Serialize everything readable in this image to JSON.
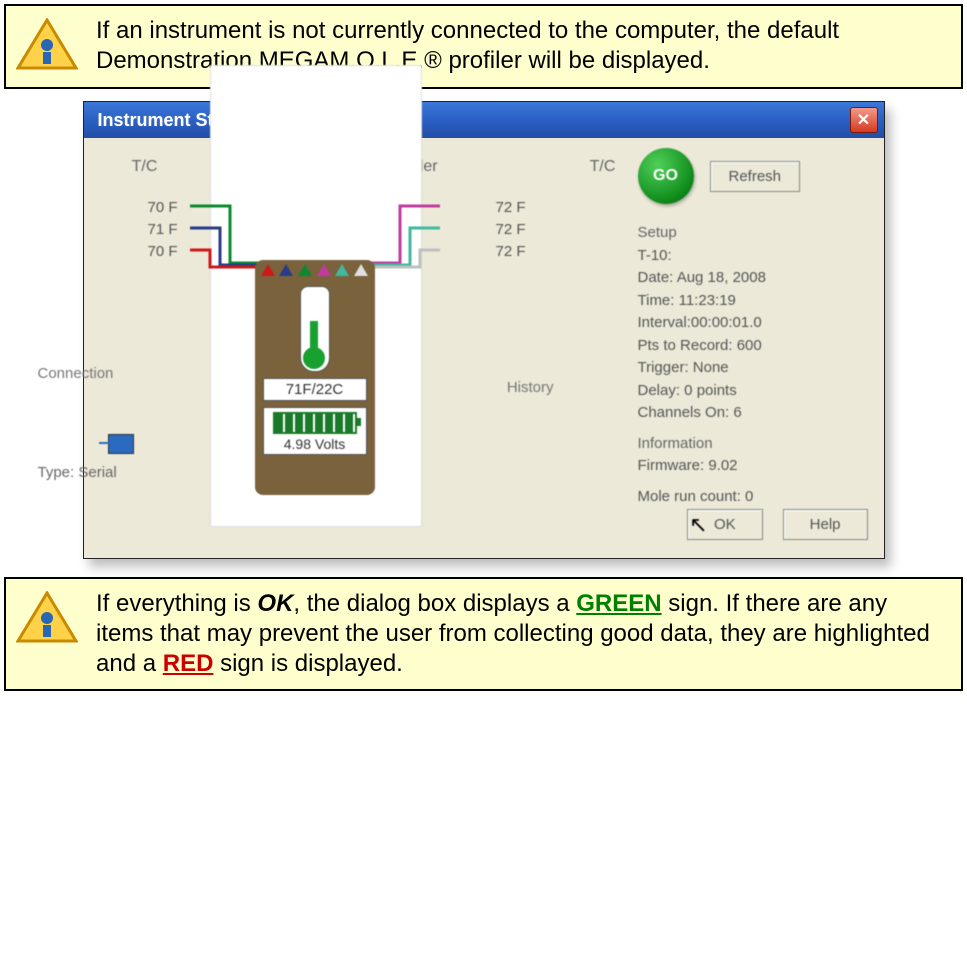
{
  "note_top": {
    "text": "If an instrument is not currently connected to the computer, the default Demonstration MEGAM.O.L.E.® profiler will be displayed."
  },
  "note_bottom": {
    "pre": "If everything is ",
    "ok": "OK",
    "mid1": ", the dialog box displays a ",
    "green": "GREEN",
    "mid2": " sign. If there are any items that may prevent the user from collecting good data, they are highlighted and a ",
    "red": "RED",
    "post": " sign is displayed."
  },
  "dialog": {
    "title": "Instrument Status",
    "labels": {
      "tc_left": "T/C",
      "profiler": "M.O.L.E. Profiler",
      "tc_right": "T/C",
      "connection": "Connection",
      "history": "History"
    },
    "go": "GO",
    "refresh": "Refresh",
    "temps_left": [
      "70 F",
      "71 F",
      "70 F"
    ],
    "temps_right": [
      "72 F",
      "72 F",
      "72 F"
    ],
    "therm_readout": "71F/22C",
    "battery_volts": "4.98 Volts",
    "conn_type": "Type: Serial",
    "setup": {
      "header": "Setup",
      "tid": "T-10:",
      "date": "Date: Aug 18, 2008",
      "time": "Time: 11:23:19",
      "interval": "Interval:00:00:01.0",
      "pts": "Pts to Record: 600",
      "trigger": "Trigger: None",
      "delay": "Delay: 0 points",
      "channels": "Channels On: 6"
    },
    "info": {
      "header": "Information",
      "firmware": "Firmware: 9.02"
    },
    "runcount": "Mole run count: 0",
    "ok_btn": "OK",
    "help_btn": "Help"
  }
}
